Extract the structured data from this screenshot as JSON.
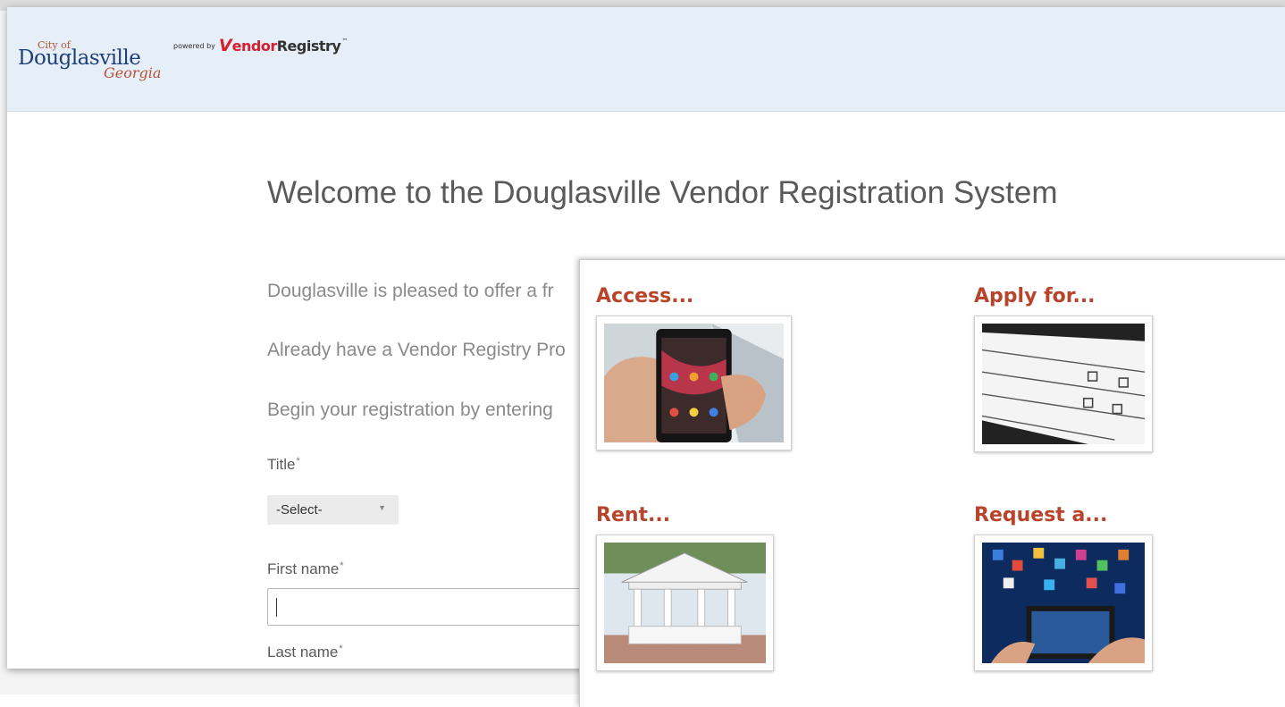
{
  "header": {
    "city_logo": {
      "prefix": "City of",
      "name": "Douglasville",
      "state": "Georgia"
    },
    "vendor_logo": {
      "powered_by": "powered by",
      "mark": "V",
      "name_red": "endor",
      "name_dark": "Registry",
      "tm": "™"
    }
  },
  "main": {
    "title": "Welcome to the Douglasville Vendor Registration System",
    "paragraphs": [
      "Douglasville is pleased to offer a fr",
      "Already have a Vendor Registry Pro",
      "Begin your registration by entering"
    ],
    "form": {
      "title_label": "Title",
      "title_select_value": "-Select-",
      "first_name_label": "First name",
      "first_name_value": "",
      "last_name_label": "Last name",
      "required_marker": "*"
    }
  },
  "overlay": {
    "services": [
      {
        "label": "Access...",
        "image": "smartphone-photo"
      },
      {
        "label": "Apply for...",
        "image": "application-form-photo"
      },
      {
        "label": "Rent...",
        "image": "gazebo-photo"
      },
      {
        "label": "Request a...",
        "image": "tablet-apps-photo"
      }
    ]
  },
  "colors": {
    "header_bg": "#e6eef7",
    "city_blue": "#1f3f78",
    "accent_red": "#b8442b",
    "vendor_red": "#d6202f"
  }
}
